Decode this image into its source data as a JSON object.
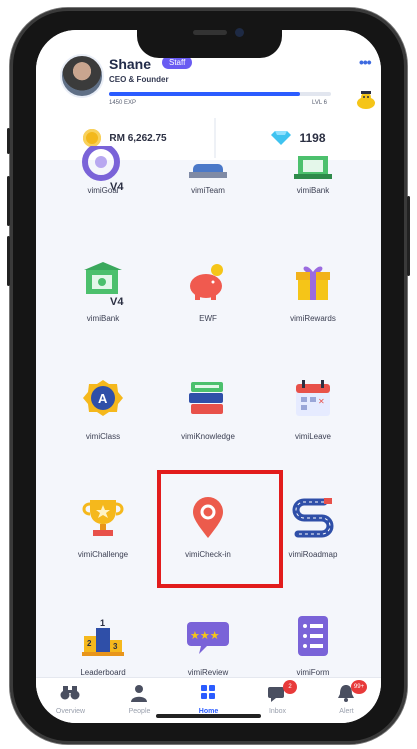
{
  "header": {
    "name": "Shane",
    "badge": "Staff",
    "title": "CEO & Founder",
    "xp": "1450 EXP",
    "level": "LVL 6",
    "xp_progress": 0.86
  },
  "wallet": {
    "balance": "RM 6,262.75",
    "diamonds": "1198"
  },
  "apps": [
    {
      "label": "vimiGoal",
      "icon": "goal-target-icon"
    },
    {
      "label": "vimiTeam",
      "icon": "team-icon"
    },
    {
      "label": "vimiBank",
      "icon": "bank-icon"
    },
    {
      "label": "vimiBank",
      "icon": "bank-v4-icon"
    },
    {
      "label": "EWF",
      "icon": "piggy-bank-icon"
    },
    {
      "label": "vimiRewards",
      "icon": "gift-icon"
    },
    {
      "label": "vimiClass",
      "icon": "class-badge-icon"
    },
    {
      "label": "vimiKnowledge",
      "icon": "books-icon"
    },
    {
      "label": "vimiLeave",
      "icon": "calendar-icon"
    },
    {
      "label": "vimiChallenge",
      "icon": "trophy-icon"
    },
    {
      "label": "vimiCheck-in",
      "icon": "location-pin-icon"
    },
    {
      "label": "vimiRoadmap",
      "icon": "roadmap-icon"
    },
    {
      "label": "Leaderboard",
      "icon": "podium-icon"
    },
    {
      "label": "vimiReview",
      "icon": "stars-review-icon"
    },
    {
      "label": "vimiForm",
      "icon": "form-icon"
    }
  ],
  "nav": [
    {
      "label": "Overview",
      "icon": "binoculars-icon"
    },
    {
      "label": "People",
      "icon": "person-icon"
    },
    {
      "label": "Home",
      "icon": "home-grid-icon",
      "active": true
    },
    {
      "label": "Inbox",
      "icon": "chat-icon",
      "badge": "2"
    },
    {
      "label": "Alert",
      "icon": "bell-icon",
      "badge": "99+"
    }
  ],
  "colors": {
    "accent": "#2b5cff",
    "highlight": "#e21c1c",
    "badge_purple": "#6a5cf2"
  }
}
